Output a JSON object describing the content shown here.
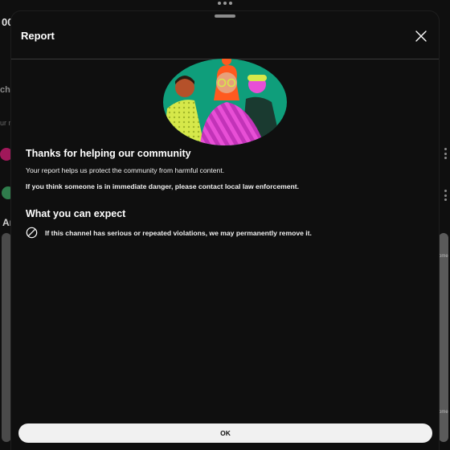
{
  "background": {
    "top_fragment": "00'",
    "left_fragment_1": "che",
    "left_fragment_2": "ur m",
    "left_fragment_3": "Ar",
    "right_fragment_1": "ome",
    "right_fragment_2": "ome"
  },
  "modal": {
    "title": "Report",
    "section1": {
      "heading": "Thanks for helping our community",
      "body": "Your report helps us protect the community from harmful content.",
      "emphasis": "If you think someone is in immediate danger, please contact local law enforcement."
    },
    "section2": {
      "heading": "What you can expect",
      "item": "If this channel has serious or repeated violations, we may permanently remove it.",
      "item_icon": "prohibited-icon"
    },
    "ok_label": "OK",
    "close_icon": "close-icon"
  },
  "colors": {
    "background": "#0f0f0f",
    "text": "#ffffff",
    "button_bg": "#f1f1f1",
    "illustration_green": "#0f9e7b",
    "illustration_pink": "#e84fd6",
    "illustration_orange": "#ff5a1f",
    "illustration_yellow": "#d6e84a"
  }
}
